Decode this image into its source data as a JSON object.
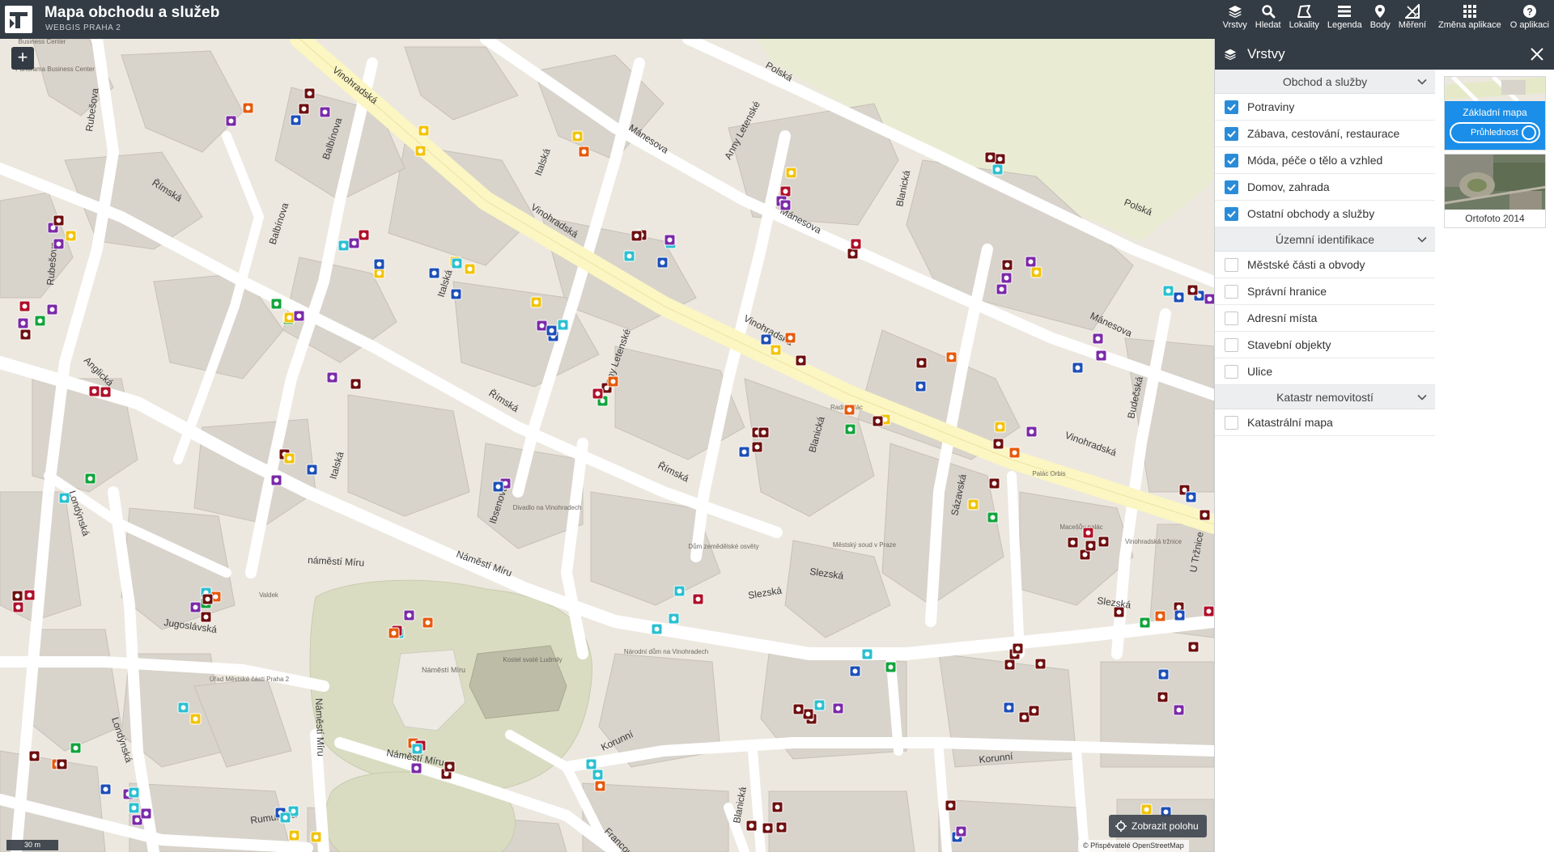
{
  "header": {
    "title": "Mapa obchodu a služeb",
    "subtitle": "WEBGIS PRAHA 2",
    "tools": [
      {
        "label": "Vrstvy",
        "icon": "layers-icon"
      },
      {
        "label": "Hledat",
        "icon": "search-icon"
      },
      {
        "label": "Lokality",
        "icon": "polygon-icon"
      },
      {
        "label": "Legenda",
        "icon": "legend-icon"
      },
      {
        "label": "Body",
        "icon": "map-pin-icon"
      },
      {
        "label": "Měření",
        "icon": "ruler-icon"
      },
      {
        "label": "Změna aplikace",
        "icon": "apps-grid-icon"
      },
      {
        "label": "O aplikaci",
        "icon": "help-icon"
      }
    ]
  },
  "map": {
    "zoom_in": "+",
    "scale": "30 m",
    "locate_label": "Zobrazit polohu",
    "attribution": "© Přispěvatelé OpenStreetMap",
    "streets": [
      "Vinohradská",
      "Vinohradská",
      "Vinohradská",
      "Vinohradská",
      "Polská",
      "Polská",
      "Mánesova",
      "Mánesova",
      "Mánesova",
      "Anny Letenské",
      "Anny Letenské",
      "Italská",
      "Italská",
      "Italská",
      "Balbínova",
      "Balbínova",
      "Rubešova",
      "Rubešova",
      "Římská",
      "Římská",
      "Římská",
      "Anglická",
      "Londýnská",
      "Londýnská",
      "náměstí Míru",
      "Náměstí Míru",
      "Náměstí Míru",
      "Náměstí Míru",
      "Slezská",
      "Slezská",
      "Slezská",
      "Jugoslávská",
      "Rumunská",
      "Korunní",
      "Korunní",
      "Blanická",
      "Blanická",
      "Blanická",
      "Sázavská",
      "Budečská",
      "U Tržnice",
      "Ibsenova",
      "Francouzská"
    ],
    "places": [
      "Business Center",
      "Panorama Business Center",
      "Radiopalác",
      "Divadlo na Vinohradech",
      "Dům zemědělské osvěty",
      "Národní dům na Vinohradech",
      "Valdek",
      "Úřad Městské části Praha 2",
      "Náměstí Míru",
      "Kostel svaté Ludmily",
      "Městský soud v Praze",
      "Palác Orbis",
      "Macešův palác",
      "Vinohradská tržnice"
    ],
    "poi_colors": {
      "food": "#6e0f0f",
      "pharmacy": "#b0102a",
      "fashion": "#7b2aa8",
      "home": "#1d4fb8",
      "leisure": "#e65a0c",
      "services": "#2bc0d0",
      "garden": "#12a43c",
      "other": "#f2c40a"
    },
    "route_color": "#fbf6c2"
  },
  "panel": {
    "title": "Vrstvy",
    "groups": [
      {
        "title": "Obchod a služby",
        "items": [
          {
            "label": "Potraviny",
            "checked": true
          },
          {
            "label": "Zábava, cestování, restaurace",
            "checked": true
          },
          {
            "label": "Móda, péče o tělo a vzhled",
            "checked": true
          },
          {
            "label": "Domov, zahrada",
            "checked": true
          },
          {
            "label": "Ostatní obchody a služby",
            "checked": true
          }
        ]
      },
      {
        "title": "Územní identifikace",
        "items": [
          {
            "label": "Městské části a obvody",
            "checked": false
          },
          {
            "label": "Správní hranice",
            "checked": false
          },
          {
            "label": "Adresní místa",
            "checked": false
          },
          {
            "label": "Stavební objekty",
            "checked": false
          },
          {
            "label": "Ulice",
            "checked": false
          }
        ]
      },
      {
        "title": "Katastr nemovitostí",
        "items": [
          {
            "label": "Katastrální mapa",
            "checked": false
          }
        ]
      }
    ],
    "basemaps": [
      {
        "label": "Základní mapa",
        "opacity_label": "Průhlednost",
        "active": true
      },
      {
        "label": "Ortofoto 2014",
        "active": false
      }
    ]
  }
}
